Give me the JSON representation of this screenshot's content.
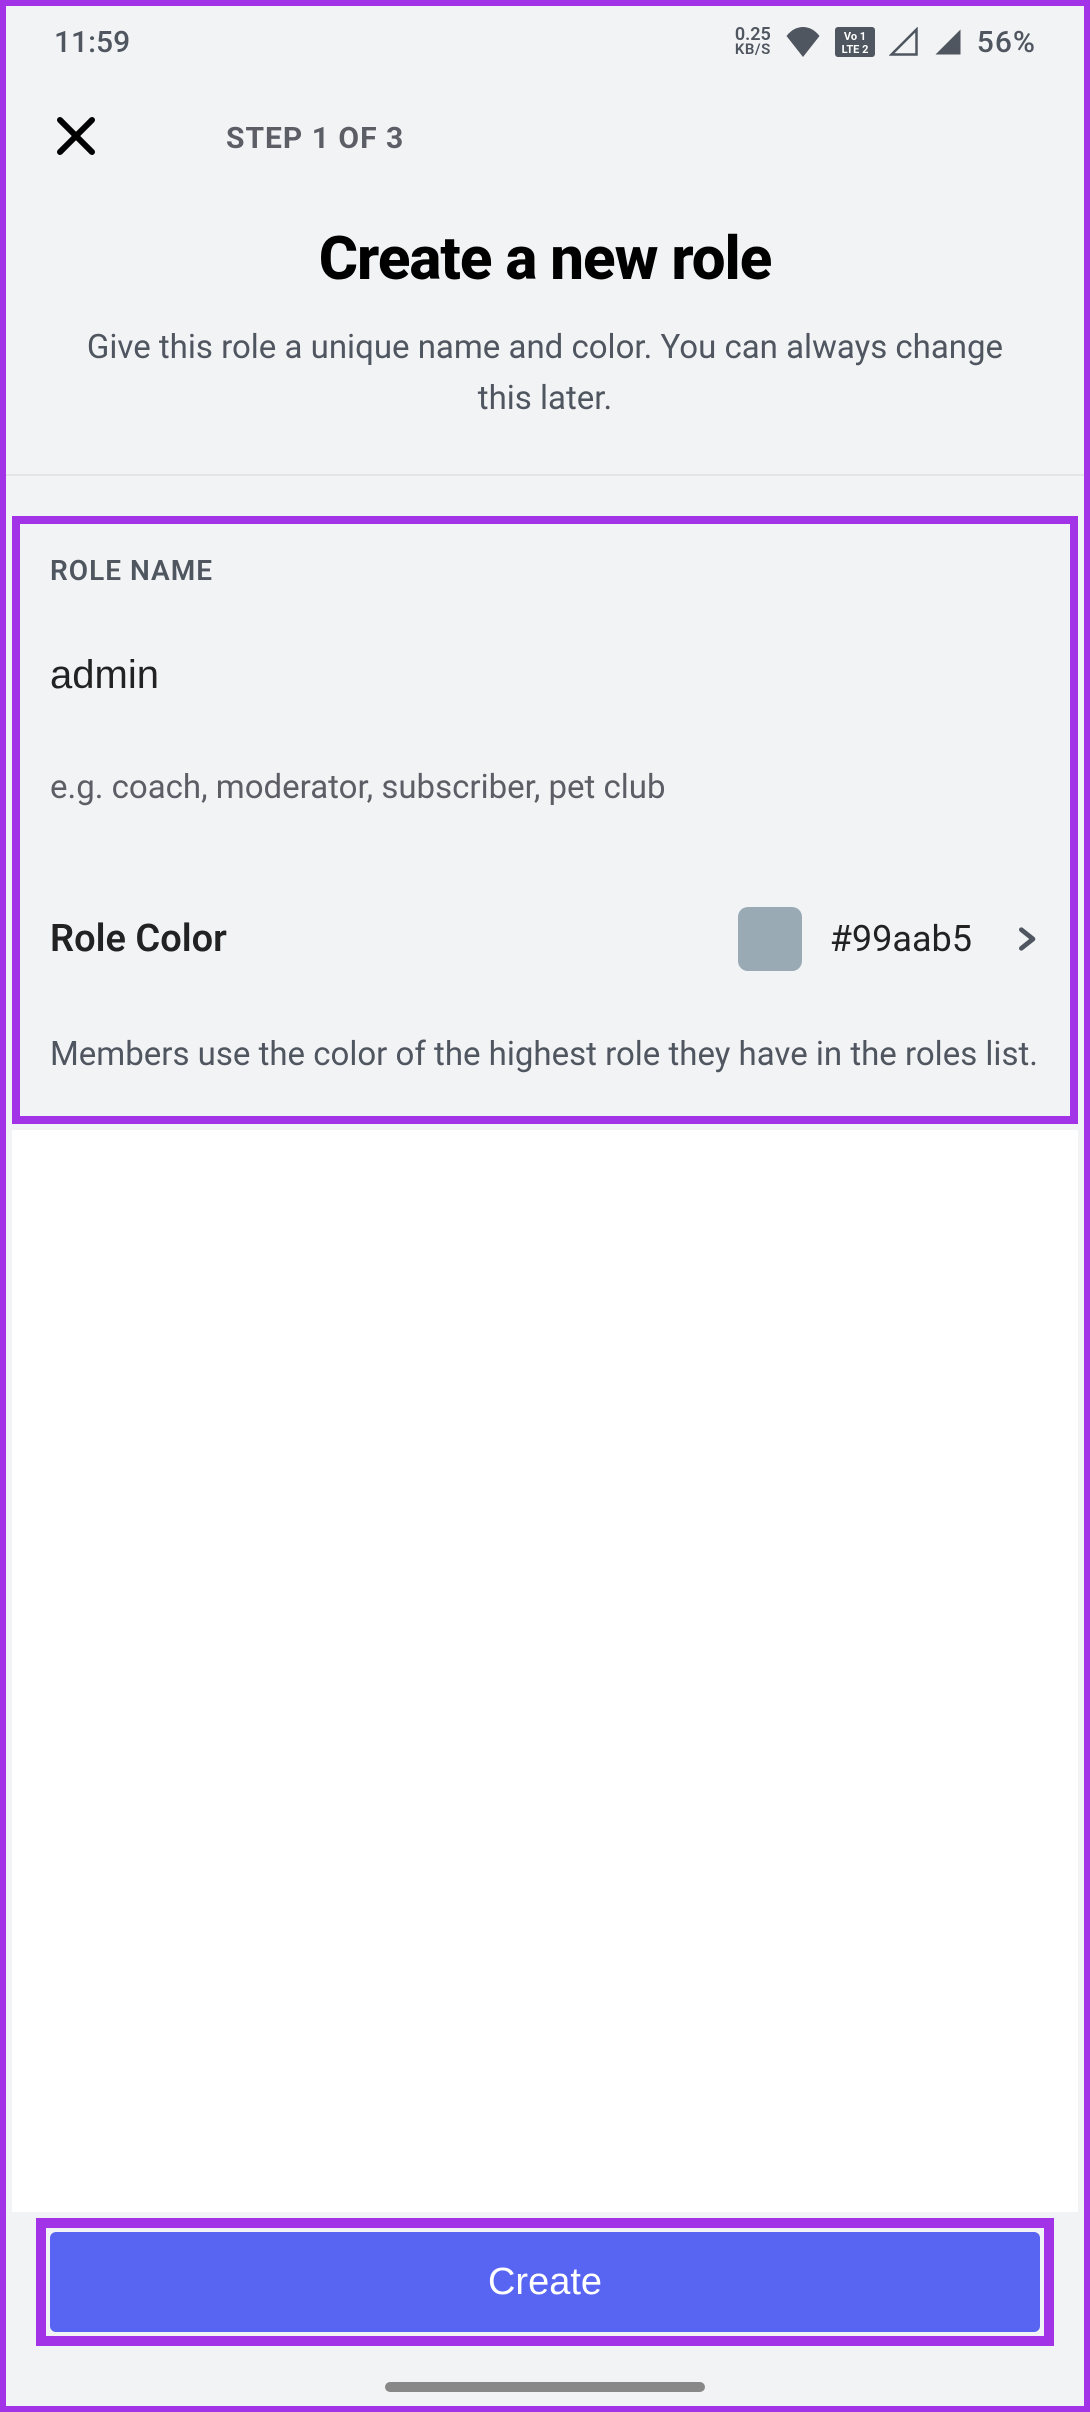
{
  "status": {
    "time": "11:59",
    "kbs_top": "0.25",
    "kbs_bot": "KB/S",
    "battery": "56%"
  },
  "header": {
    "step": "STEP 1 OF 3",
    "title": "Create a new role",
    "subtitle": "Give this role a unique name and color. You can always change this later."
  },
  "form": {
    "role_name_label": "ROLE NAME",
    "role_name_value": "admin",
    "role_name_hint": "e.g. coach, moderator, subscriber, pet club",
    "color_label": "Role Color",
    "color_value": "#99aab5",
    "color_swatch": "#99aab5",
    "color_desc": "Members use the color of the highest role they have in the roles list."
  },
  "footer": {
    "create_label": "Create"
  }
}
